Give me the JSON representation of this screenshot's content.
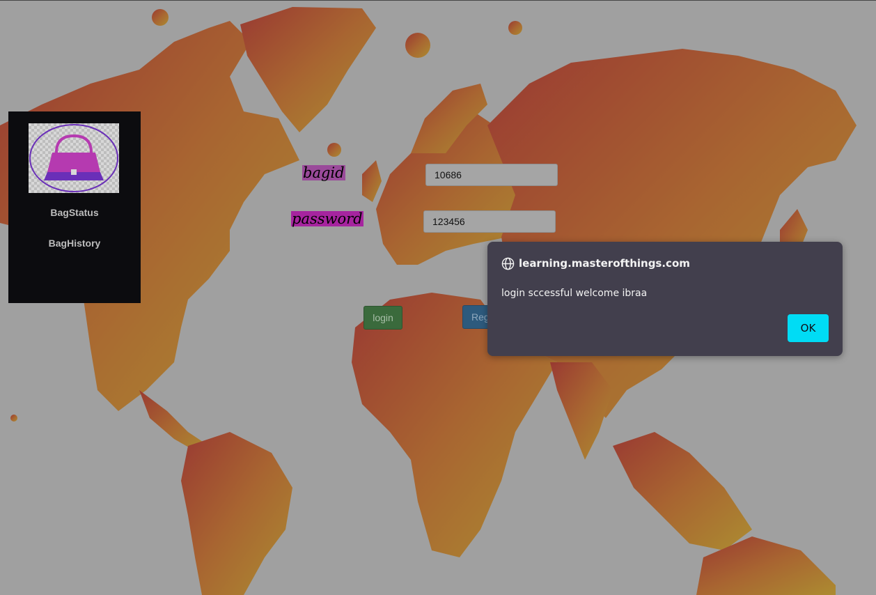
{
  "sidebar": {
    "logo_icon": "handbag-icon",
    "items": [
      {
        "label": "BagStatus"
      },
      {
        "label": "BagHistory"
      }
    ]
  },
  "form": {
    "bagid_label": "bagid",
    "bagid_value": "10686",
    "password_label": "password",
    "password_value": "123456",
    "login_label": "login",
    "register_label": "Reg"
  },
  "dialog": {
    "origin": "learning.masterofthings.com",
    "message": "login sccessful welcome ibraa",
    "ok_label": "OK"
  },
  "colors": {
    "map_red": "#c42414",
    "map_orange": "#e07a10",
    "map_yellow": "#e0a812",
    "ok_button": "#00dcf5",
    "dialog_bg": "#423f4d"
  }
}
